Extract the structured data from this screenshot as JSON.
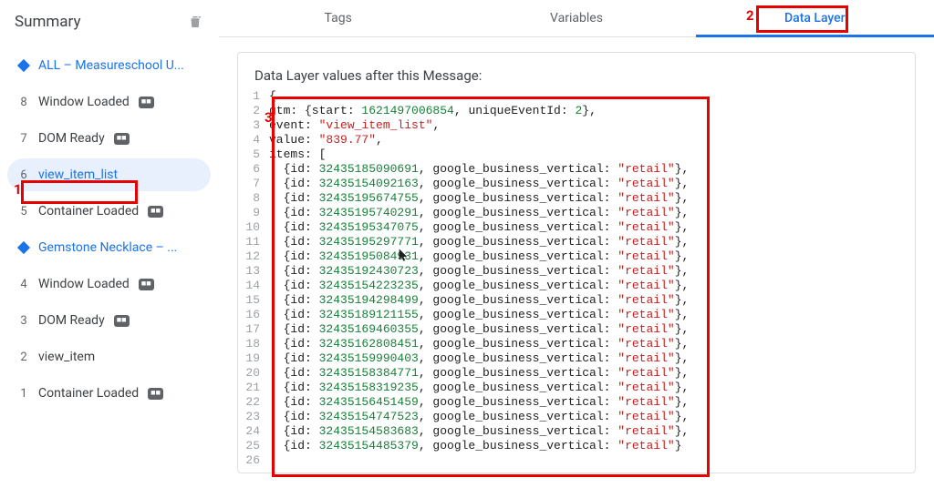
{
  "sidebar": {
    "title": "Summary",
    "items": [
      {
        "type": "group",
        "label": "ALL – Measureschool U..."
      },
      {
        "type": "event",
        "n": "8",
        "label": "Window Loaded",
        "chip": "■■"
      },
      {
        "type": "event",
        "n": "7",
        "label": "DOM Ready",
        "chip": "■■"
      },
      {
        "type": "event",
        "n": "6",
        "label": "view_item_list",
        "chip": "",
        "selected": true
      },
      {
        "type": "event",
        "n": "5",
        "label": "Container Loaded",
        "chip": "■■"
      },
      {
        "type": "group",
        "label": "Gemstone Necklace – ..."
      },
      {
        "type": "event",
        "n": "4",
        "label": "Window Loaded",
        "chip": "■■"
      },
      {
        "type": "event",
        "n": "3",
        "label": "DOM Ready",
        "chip": "■■"
      },
      {
        "type": "event",
        "n": "2",
        "label": "view_item",
        "chip": ""
      },
      {
        "type": "event",
        "n": "1",
        "label": "Container Loaded",
        "chip": "■■"
      }
    ]
  },
  "tabs": [
    "Tags",
    "Variables",
    "Data Layer"
  ],
  "panel": {
    "title": "Data Layer values after this Message:"
  },
  "dl": {
    "gtm": {
      "start": 1621497006854,
      "uniqueEventId": 2
    },
    "event": "view_item_list",
    "value": "839.77",
    "field": "google_business_vertical",
    "vertical": "retail",
    "cursor_index": 5,
    "ids": [
      32435185090691,
      32435154092163,
      32435195674755,
      32435195740291,
      32435195347075,
      32435195297771,
      32435195084931,
      32435192430723,
      32435154223235,
      32435194298499,
      32435189121155,
      32435169460355,
      32435162808451,
      32435159990403,
      32435158384771,
      32435158319235,
      32435156451459,
      32435154747523,
      32435154583683,
      32435154485379
    ]
  },
  "callouts": [
    {
      "n": "1"
    },
    {
      "n": "2"
    },
    {
      "n": "3"
    }
  ]
}
